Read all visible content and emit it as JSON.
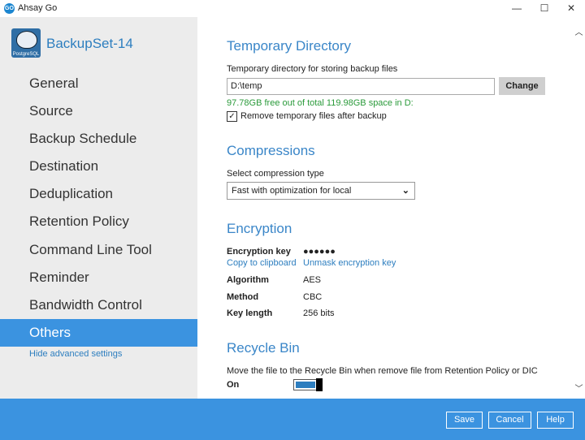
{
  "window": {
    "app_icon_text": "GO",
    "title": "Ahsay Go",
    "minimize": "—",
    "maximize": "☐",
    "close": "✕"
  },
  "sidebar": {
    "backupset_name": "BackupSet-14",
    "backupset_icon_label": "PostgreSQL",
    "items": [
      {
        "label": "General"
      },
      {
        "label": "Source"
      },
      {
        "label": "Backup Schedule"
      },
      {
        "label": "Destination"
      },
      {
        "label": "Deduplication"
      },
      {
        "label": "Retention Policy"
      },
      {
        "label": "Command Line Tool"
      },
      {
        "label": "Reminder"
      },
      {
        "label": "Bandwidth Control"
      },
      {
        "label": "Others"
      }
    ],
    "active_item": "Others",
    "hide_link": "Hide advanced settings"
  },
  "temp_dir": {
    "title": "Temporary Directory",
    "label": "Temporary directory for storing backup files",
    "value": "D:\\temp",
    "change_label": "Change",
    "free_space": "97.78GB free out of total 119.98GB space in D:",
    "checkbox_checked": "✓",
    "checkbox_label": "Remove temporary files after backup"
  },
  "compression": {
    "title": "Compressions",
    "label": "Select compression type",
    "selected": "Fast with optimization for local",
    "chevron": "⌄"
  },
  "encryption": {
    "title": "Encryption",
    "key_label": "Encryption key",
    "key_value": "●●●●●●",
    "copy_link": "Copy to clipboard",
    "unmask_link": "Unmask encryption key",
    "algorithm_label": "Algorithm",
    "algorithm_value": "AES",
    "method_label": "Method",
    "method_value": "CBC",
    "key_length_label": "Key length",
    "key_length_value": "256 bits"
  },
  "recycle_bin": {
    "title": "Recycle Bin",
    "label": "Move the file to the Recycle Bin when remove file from Retention Policy or DIC",
    "state_label": "On",
    "enabled": true
  },
  "scrollbar": {
    "up": "︿",
    "down": "﹀"
  },
  "footer": {
    "save_label": "Save",
    "cancel_label": "Cancel",
    "help_label": "Help"
  },
  "colors": {
    "accent": "#3b93e0",
    "link": "#2d7ebf",
    "section_title": "#3a86c8",
    "free_space_text": "#2a9a3a"
  }
}
